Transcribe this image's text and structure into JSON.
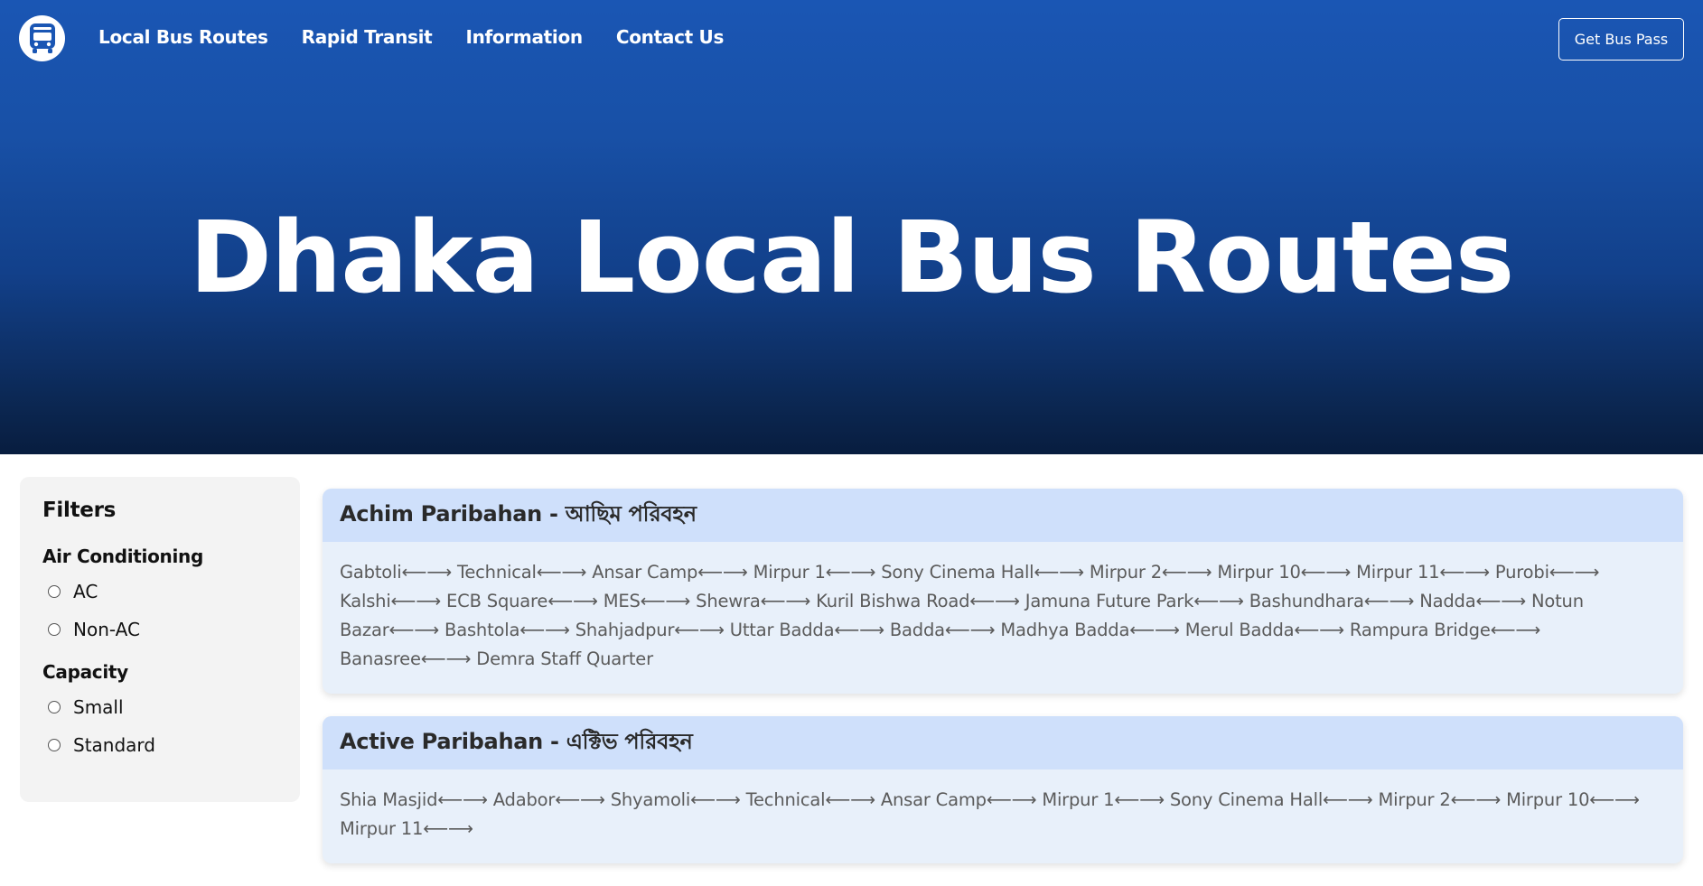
{
  "nav": {
    "logo_icon": "bus-icon",
    "links": [
      "Local Bus Routes",
      "Rapid Transit",
      "Information",
      "Contact Us"
    ],
    "cta": "Get Bus Pass"
  },
  "hero": {
    "title": "Dhaka Local Bus Routes"
  },
  "filters": {
    "title": "Filters",
    "groups": [
      {
        "title": "Air Conditioning",
        "options": [
          "AC",
          "Non-AC"
        ]
      },
      {
        "title": "Capacity",
        "options": [
          "Small",
          "Standard"
        ]
      }
    ]
  },
  "routes": [
    {
      "name": "Achim Paribahan - আছিম পরিবহন",
      "stops": "Gabtoli⟵⟶ Technical⟵⟶ Ansar Camp⟵⟶ Mirpur 1⟵⟶ Sony Cinema Hall⟵⟶ Mirpur 2⟵⟶ Mirpur 10⟵⟶ Mirpur 11⟵⟶ Purobi⟵⟶ Kalshi⟵⟶ ECB Square⟵⟶ MES⟵⟶ Shewra⟵⟶ Kuril Bishwa Road⟵⟶ Jamuna Future Park⟵⟶ Bashundhara⟵⟶ Nadda⟵⟶ Notun Bazar⟵⟶ Bashtola⟵⟶ Shahjadpur⟵⟶ Uttar Badda⟵⟶ Badda⟵⟶ Madhya Badda⟵⟶ Merul Badda⟵⟶ Rampura Bridge⟵⟶ Banasree⟵⟶ Demra Staff Quarter"
    },
    {
      "name": "Active Paribahan - এক্টিভ পরিবহন",
      "stops": "Shia Masjid⟵⟶ Adabor⟵⟶ Shyamoli⟵⟶ Technical⟵⟶ Ansar Camp⟵⟶ Mirpur 1⟵⟶ Sony Cinema Hall⟵⟶ Mirpur 2⟵⟶ Mirpur 10⟵⟶ Mirpur 11⟵⟶"
    }
  ],
  "colors": {
    "hero_top": "#1a56b4",
    "hero_bottom": "#081d3f",
    "card_header": "#cfe0fb",
    "card_body": "#e8f0fa",
    "sidebar": "#f3f3f3"
  }
}
